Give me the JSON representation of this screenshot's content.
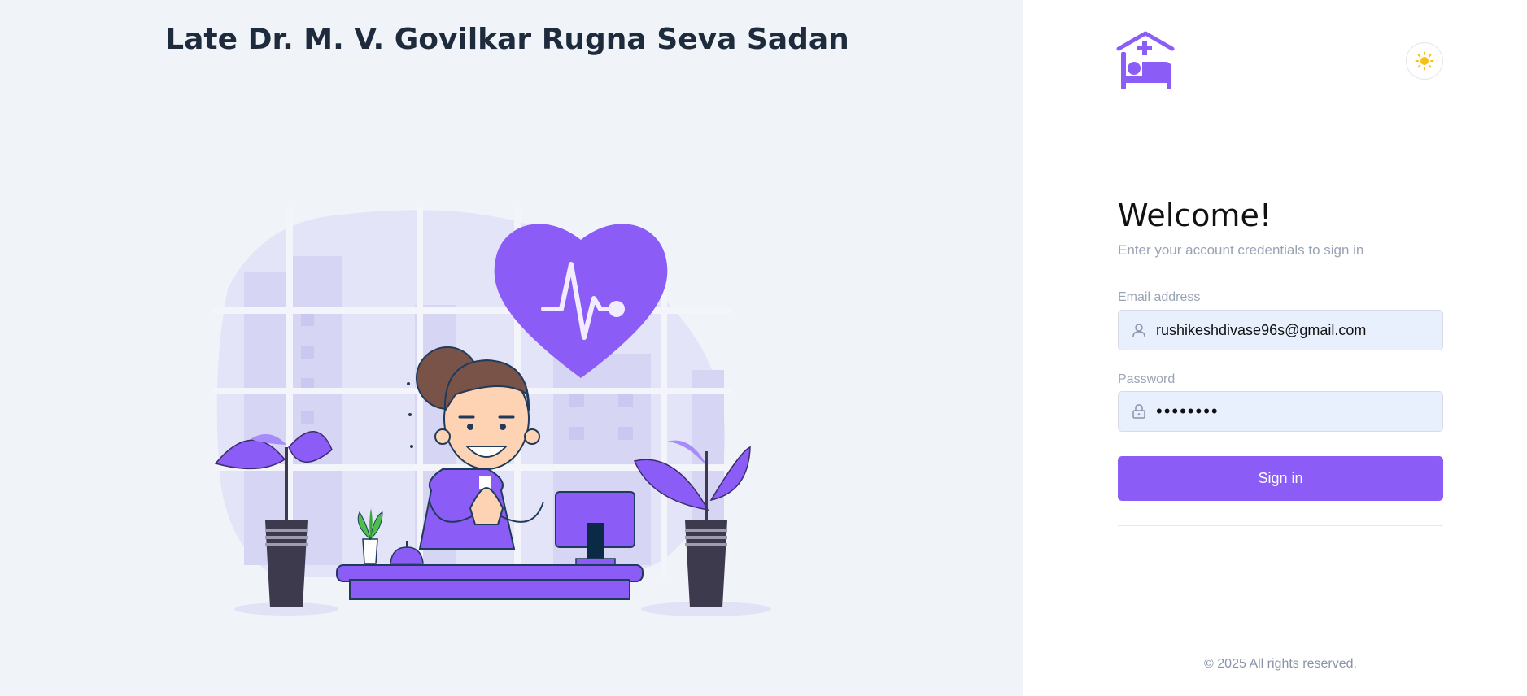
{
  "header": {
    "title": "Late Dr. M. V. Govilkar Rugna Seva Sadan"
  },
  "brand": {
    "logo_icon": "hospital-bed-icon",
    "accent": "#8b5cf6"
  },
  "theme_toggle": {
    "icon": "sun-icon"
  },
  "login": {
    "heading": "Welcome!",
    "subtitle": "Enter your account credentials to sign in",
    "email_label": "Email address",
    "email_value": "rushikeshdivase96s@gmail.com",
    "password_label": "Password",
    "password_value": "••••••••",
    "signin_label": "Sign in"
  },
  "footer": {
    "copyright": "© 2025 All rights reserved."
  }
}
